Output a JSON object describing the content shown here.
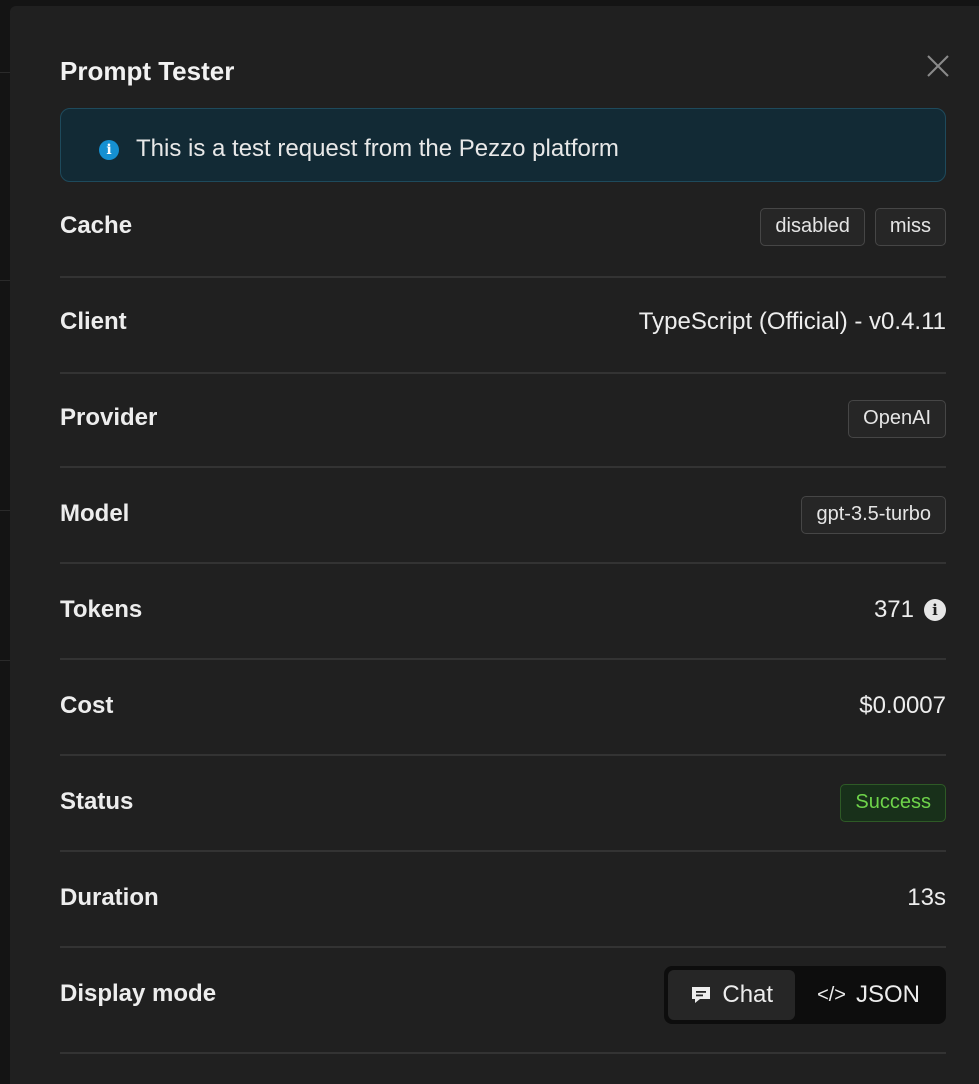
{
  "panel": {
    "title": "Prompt Tester",
    "close_icon": "close-icon"
  },
  "alert": {
    "icon": "info-circle-icon",
    "text": "This is a test request from the Pezzo platform"
  },
  "rows": {
    "cache": {
      "label": "Cache",
      "tags": [
        "disabled",
        "miss"
      ]
    },
    "client": {
      "label": "Client",
      "value": "TypeScript (Official) - v0.4.11"
    },
    "provider": {
      "label": "Provider",
      "tag": "OpenAI"
    },
    "model": {
      "label": "Model",
      "tag": "gpt-3.5-turbo"
    },
    "tokens": {
      "label": "Tokens",
      "value": "371"
    },
    "cost": {
      "label": "Cost",
      "value": "$0.0007"
    },
    "status": {
      "label": "Status",
      "tag": "Success"
    },
    "duration": {
      "label": "Duration",
      "value": "13s"
    },
    "display_mode": {
      "label": "Display mode",
      "options": [
        {
          "label": "Chat",
          "icon": "chat-icon",
          "selected": true
        },
        {
          "label": "JSON",
          "icon": "code-icon",
          "selected": false
        }
      ]
    }
  },
  "colors": {
    "panel_bg": "#202020",
    "alert_bg": "#122a35",
    "alert_icon": "#1590d2",
    "success": "#6ed34a"
  }
}
